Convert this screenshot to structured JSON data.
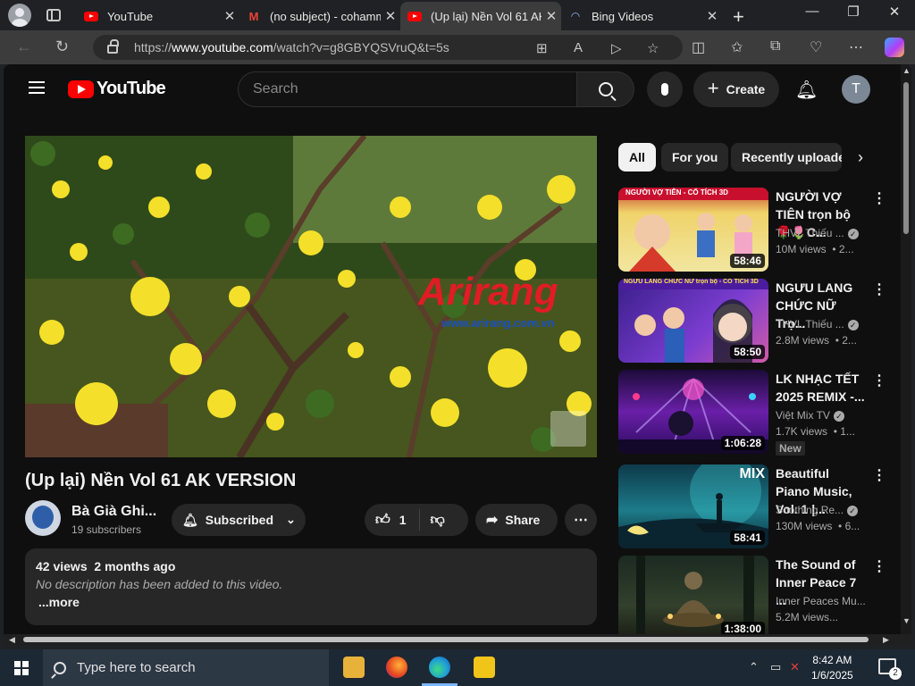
{
  "browser": {
    "tabs": [
      {
        "label": "YouTube",
        "icon": "youtube-icon",
        "active": false
      },
      {
        "label": "(no subject) - cohamm",
        "icon": "gmail-icon",
        "active": false
      },
      {
        "label": "(Up lại) Nền Vol 61 AK",
        "icon": "youtube-icon",
        "active": true
      },
      {
        "label": "Bing Videos",
        "icon": "bing-icon",
        "active": false
      }
    ],
    "url_prefix": "https://",
    "url_host": "www.youtube.com",
    "url_path": "/watch?v=g8GBYQSVruQ&t=5s"
  },
  "youtube": {
    "logo_text": "YouTube",
    "search_placeholder": "Search",
    "create_label": "Create",
    "avatar_initial": "T",
    "video": {
      "watermark": "Arirang",
      "watermark_url": "www.arirang.com.vn",
      "title": "(Up lại) Nền Vol 61 AK VERSION",
      "channel": "Bà Già Ghi...",
      "subscribers": "19 subscribers",
      "subscribe_label": "Subscribed",
      "likes": "1",
      "share_label": "Share",
      "views": "42 views",
      "age": "2 months ago",
      "description": "No description has been added to this video.",
      "more_label": "...more"
    },
    "chips": [
      {
        "label": "All",
        "selected": true
      },
      {
        "label": "For you",
        "selected": false
      },
      {
        "label": "Recently uploaded",
        "selected": false
      }
    ],
    "recommendations": [
      {
        "title": "NGƯỜI VỢ TIÊN trọn bộ🌹🌷C...",
        "channel": "THVL Thiếu ...",
        "views": "10M views",
        "age": "• 2...",
        "duration": "58:46",
        "thumb_text": "NGƯỜI VỢ TIÊN - CỔ TÍCH 3D",
        "badge": ""
      },
      {
        "title": "NGƯU LANG CHỨC NỮ Trọ...",
        "channel": "THVL Thiếu ...",
        "views": "2.8M views",
        "age": "• 2...",
        "duration": "58:50",
        "thumb_text": "NGƯU LANG CHỨC NỮ trọn bộ - CỔ TÍCH 3D",
        "badge": ""
      },
      {
        "title": "LK NHẠC TẾT 2025 REMIX -...",
        "channel": "Việt Mix TV",
        "views": "1.7K views",
        "age": "• 1...",
        "duration": "1:06:28",
        "thumb_text": "",
        "badge": "New"
      },
      {
        "title": "Beautiful Piano Music, Vol. 1 |...",
        "channel": "Soothing Re...",
        "views": "130M views",
        "age": "• 6...",
        "duration": "58:41",
        "thumb_text": "MIX",
        "badge": ""
      },
      {
        "title": "The Sound of Inner Peace 7 ...",
        "channel": "Inner Peaces Mu...",
        "views": "5.2M views...",
        "age": "",
        "duration": "1:38:00",
        "thumb_text": "",
        "badge": ""
      }
    ]
  },
  "taskbar": {
    "search_placeholder": "Type here to search",
    "time": "8:42 AM",
    "date": "1/6/2025",
    "notification_count": "2"
  },
  "colors": {
    "youtube_red": "#ff0000",
    "page_bg": "#0f0f0f",
    "chip_bg": "#272727",
    "taskbar_bg": "#1c2833"
  }
}
